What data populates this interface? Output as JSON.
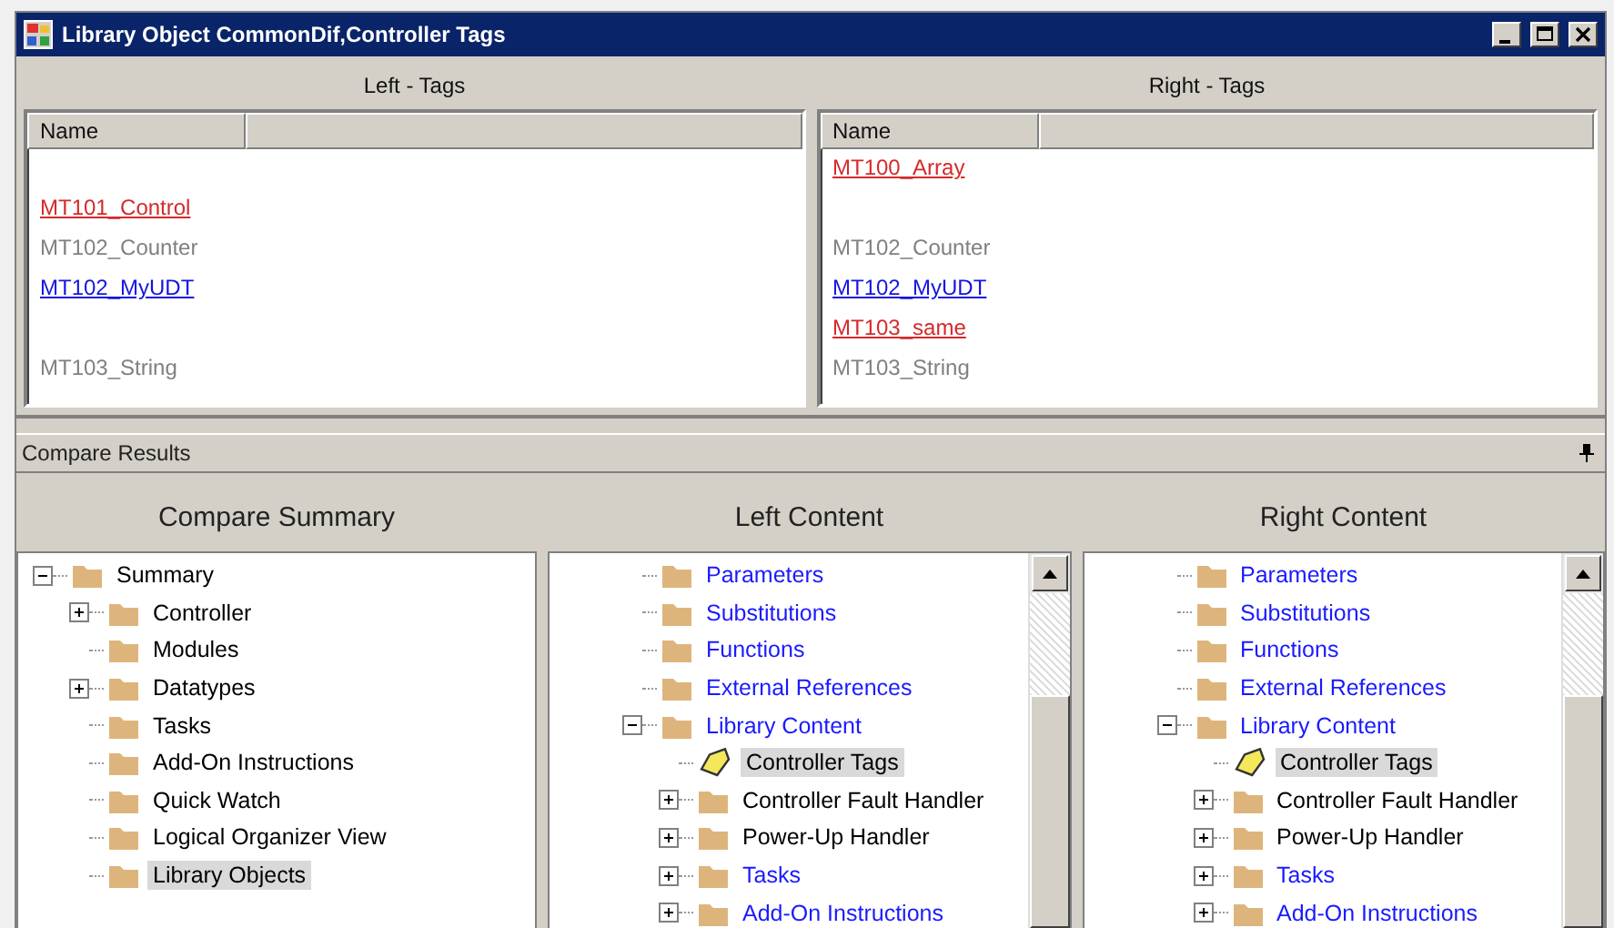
{
  "window": {
    "title": "Library Object CommonDif,Controller Tags"
  },
  "tag_panes": [
    {
      "title": "Left - Tags",
      "columns": [
        "Name"
      ],
      "rows": [
        {
          "kind": "blank"
        },
        {
          "kind": "changed",
          "name": "MT101_Control"
        },
        {
          "kind": "unchanged",
          "name": "MT102_Counter"
        },
        {
          "kind": "modified",
          "name": "MT102_MyUDT"
        },
        {
          "kind": "blank"
        },
        {
          "kind": "unchanged",
          "name": "MT103_String"
        }
      ]
    },
    {
      "title": "Right - Tags",
      "columns": [
        "Name"
      ],
      "rows": [
        {
          "kind": "changed",
          "name": "MT100_Array"
        },
        {
          "kind": "blank"
        },
        {
          "kind": "unchanged",
          "name": "MT102_Counter"
        },
        {
          "kind": "modified",
          "name": "MT102_MyUDT"
        },
        {
          "kind": "changed",
          "name": "MT103_same"
        },
        {
          "kind": "unchanged",
          "name": "MT103_String"
        }
      ]
    }
  ],
  "compare_results": {
    "title": "Compare Results"
  },
  "trees": [
    {
      "title": "Compare Summary",
      "items": [
        {
          "label": "Summary",
          "kind": "folder_open",
          "color": "#000000",
          "selected": false,
          "children": [
            {
              "label": "Controller",
              "kind": "folder_closed",
              "color": "#000000",
              "selected": false
            },
            {
              "label": "Modules",
              "kind": "folder",
              "color": "#000000",
              "selected": false
            },
            {
              "label": "Datatypes",
              "kind": "folder_closed",
              "color": "#000000",
              "selected": false
            },
            {
              "label": "Tasks",
              "kind": "folder",
              "color": "#000000",
              "selected": false
            },
            {
              "label": "Add-On Instructions",
              "kind": "folder",
              "color": "#000000",
              "selected": false
            },
            {
              "label": "Quick Watch",
              "kind": "folder",
              "color": "#000000",
              "selected": false
            },
            {
              "label": "Logical Organizer View",
              "kind": "folder",
              "color": "#000000",
              "selected": false
            },
            {
              "label": "Library Objects",
              "kind": "folder",
              "color": "#000000",
              "selected": true
            }
          ]
        }
      ]
    },
    {
      "title": "Left Content",
      "items": [
        {
          "label": "Parameters",
          "kind": "folder",
          "color": "#1a1aff",
          "selected": false
        },
        {
          "label": "Substitutions",
          "kind": "folder",
          "color": "#1a1aff",
          "selected": false
        },
        {
          "label": "Functions",
          "kind": "folder",
          "color": "#1a1aff",
          "selected": false
        },
        {
          "label": "External References",
          "kind": "folder",
          "color": "#1a1aff",
          "selected": false
        },
        {
          "label": "Library Content",
          "kind": "folder_open",
          "color": "#1a1aff",
          "selected": false,
          "children": [
            {
              "label": "Controller Tags",
              "kind": "tag",
              "color": "#000000",
              "selected": true
            },
            {
              "label": "Controller Fault Handler",
              "kind": "folder_closed",
              "color": "#000000",
              "selected": false
            },
            {
              "label": "Power-Up Handler",
              "kind": "folder_closed",
              "color": "#000000",
              "selected": false
            },
            {
              "label": "Tasks",
              "kind": "folder_closed",
              "color": "#1a1aff",
              "selected": false
            },
            {
              "label": "Add-On Instructions",
              "kind": "folder_closed",
              "color": "#1a1aff",
              "selected": false
            }
          ]
        }
      ]
    },
    {
      "title": "Right Content",
      "items": [
        {
          "label": "Parameters",
          "kind": "folder",
          "color": "#1a1aff",
          "selected": false
        },
        {
          "label": "Substitutions",
          "kind": "folder",
          "color": "#1a1aff",
          "selected": false
        },
        {
          "label": "Functions",
          "kind": "folder",
          "color": "#1a1aff",
          "selected": false
        },
        {
          "label": "External References",
          "kind": "folder",
          "color": "#1a1aff",
          "selected": false
        },
        {
          "label": "Library Content",
          "kind": "folder_open",
          "color": "#1a1aff",
          "selected": false,
          "children": [
            {
              "label": "Controller Tags",
              "kind": "tag",
              "color": "#000000",
              "selected": true
            },
            {
              "label": "Controller Fault Handler",
              "kind": "folder_closed",
              "color": "#000000",
              "selected": false
            },
            {
              "label": "Power-Up Handler",
              "kind": "folder_closed",
              "color": "#000000",
              "selected": false
            },
            {
              "label": "Tasks",
              "kind": "folder_closed",
              "color": "#1a1aff",
              "selected": false
            },
            {
              "label": "Add-On Instructions",
              "kind": "folder_closed",
              "color": "#1a1aff",
              "selected": false
            }
          ]
        }
      ]
    }
  ]
}
